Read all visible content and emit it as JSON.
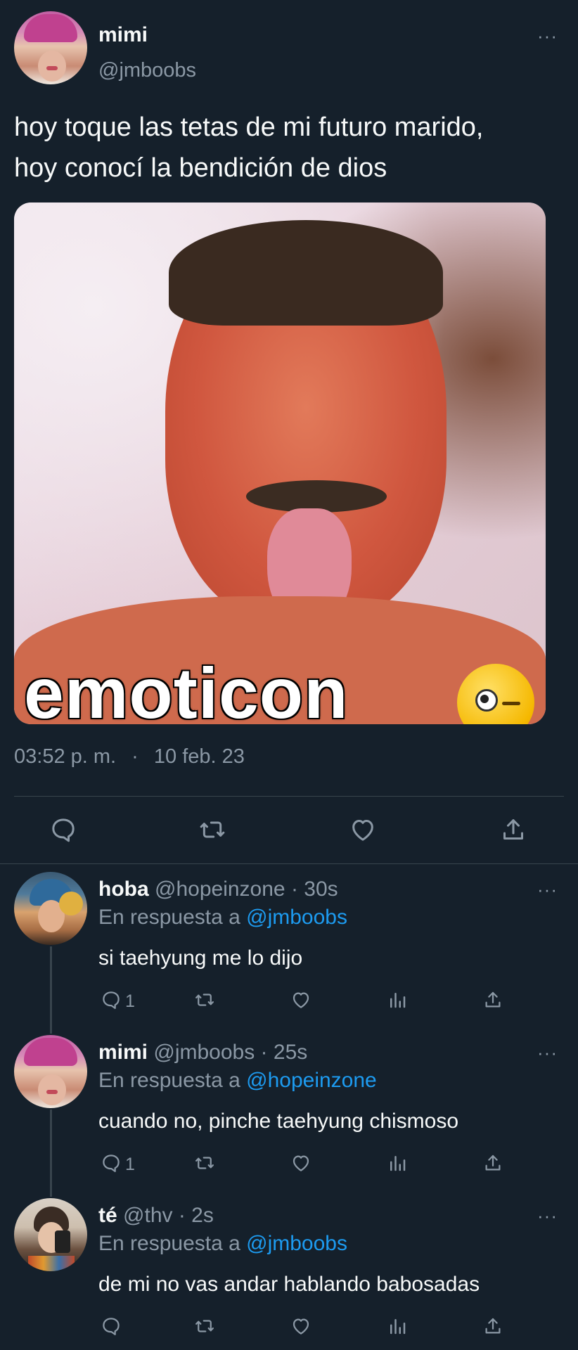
{
  "main_tweet": {
    "name": "mimi",
    "handle": "@jmboobs",
    "more": "···",
    "text_line1": "hoy toque las tetas de mi futuro marido,",
    "text_line2": "hoy conocí la bendición de dios",
    "media_caption": "emoticon",
    "time": "03:52 p. m.",
    "separator": "·",
    "date": "10 feb. 23"
  },
  "replies": [
    {
      "name": "hoba",
      "handle": "@hopeinzone · 30s",
      "reply_prefix": "En respuesta a",
      "reply_to": "@jmboobs",
      "text": "si taehyung me lo dijo",
      "reply_count": "1",
      "more": "···"
    },
    {
      "name": "mimi",
      "handle": "@jmboobs · 25s",
      "reply_prefix": "En respuesta a",
      "reply_to": "@hopeinzone",
      "text": "cuando no, pinche taehyung chismoso",
      "reply_count": "1",
      "more": "···"
    },
    {
      "name": "té",
      "handle": "@thv · 2s",
      "reply_prefix": "En respuesta a",
      "reply_to": "@jmboobs",
      "text": "de mi no vas andar hablando babosadas",
      "reply_count": "",
      "more": "···"
    }
  ],
  "icons": [
    "reply-icon",
    "retweet-icon",
    "like-icon",
    "views-icon",
    "share-icon",
    "more-icon"
  ],
  "colors": {
    "background": "#15202b",
    "text": "#f7f9f9",
    "muted": "#8b98a5",
    "link": "#1d9bf0",
    "divider": "#38444d"
  }
}
